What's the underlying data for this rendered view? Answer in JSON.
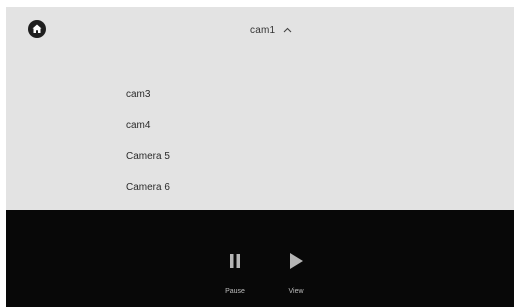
{
  "header": {
    "home_icon": "home-icon",
    "camera_selected": "cam1",
    "dropdown_icon": "chevron-up-icon"
  },
  "dropdown": {
    "items": [
      {
        "label": "cam3"
      },
      {
        "label": "cam4"
      },
      {
        "label": "Camera 5"
      },
      {
        "label": "Camera 6"
      }
    ]
  },
  "controls": {
    "pause_label": "Pause",
    "pause_icon": "pause-icon",
    "view_label": "View",
    "view_icon": "play-icon"
  },
  "colors": {
    "panel_bg": "#e3e3e3",
    "bar_bg": "#080808",
    "icon_gray": "#b5b5b5"
  }
}
